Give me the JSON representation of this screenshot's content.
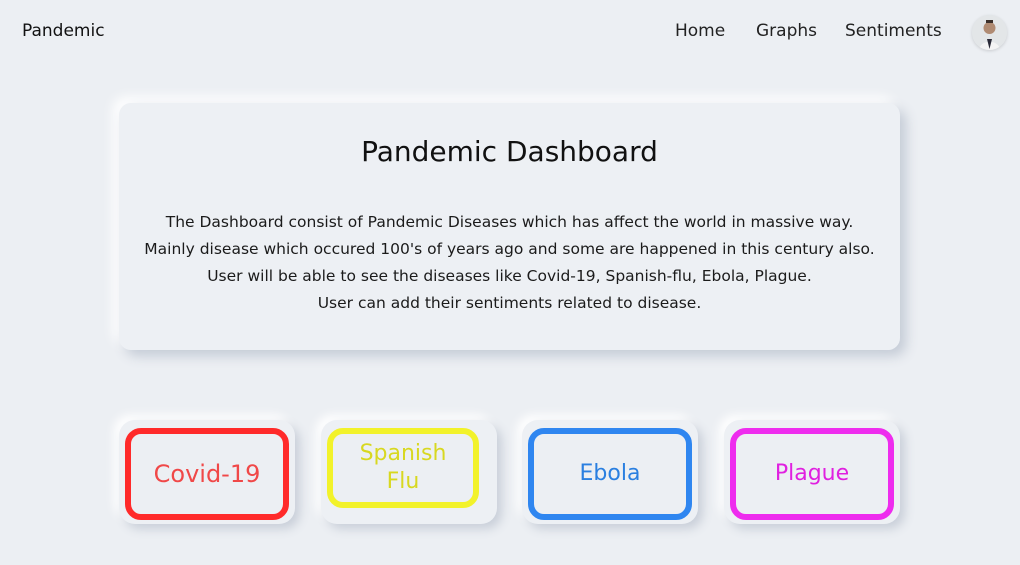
{
  "nav": {
    "brand": "Pandemic",
    "links": [
      "Home",
      "Graphs",
      "Sentiments"
    ]
  },
  "card": {
    "title": "Pandemic Dashboard",
    "lines": [
      "The Dashboard consist of Pandemic Diseases which has affect the world in massive way.",
      "Mainly disease which occured 100's of years ago and some are happened in this century also.",
      "User will be able to see the diseases like Covid-19, Spanish-flu, Ebola, Plague.",
      "User can add their sentiments related to disease."
    ]
  },
  "diseases": [
    {
      "label": "Covid-19",
      "color": "#f04848",
      "border": "#ff2a2a"
    },
    {
      "label": "Spanish Flu",
      "color": "#d8d820",
      "border": "#f2f22a"
    },
    {
      "label": "Ebola",
      "color": "#2a7fe0",
      "border": "#2f86f0"
    },
    {
      "label": "Plague",
      "color": "#e020e0",
      "border": "#ee2cee"
    }
  ],
  "colors": {
    "background": "#eceff3"
  }
}
